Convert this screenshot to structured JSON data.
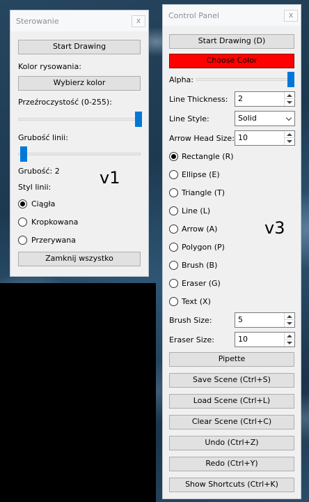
{
  "v1": {
    "title": "Sterowanie",
    "close": "x",
    "start_drawing": "Start Drawing",
    "color_label": "Kolor rysowania:",
    "choose_color": "Wybierz kolor",
    "transparency_label": "Przeźroczystość (0-255):",
    "transparency_value": 255,
    "line_width_label": "Grubość linii:",
    "line_width_value": 2,
    "line_width_readout": "Grubość: 2",
    "line_style_label": "Styl linii:",
    "styles": [
      "Ciągła",
      "Kropkowana",
      "Przerywana"
    ],
    "selected_style": "Ciągła",
    "close_all": "Zamknij wszystko",
    "version_tag": "v1"
  },
  "v3": {
    "title": "Control Panel",
    "close": "x",
    "start_drawing": "Start Drawing (D)",
    "choose_color": "Choose Color",
    "choose_color_bg": "#ff0000",
    "alpha_label": "Alpha:",
    "alpha_value": 255,
    "line_thickness_label": "Line Thickness:",
    "line_thickness_value": "2",
    "line_style_label": "Line Style:",
    "line_style_value": "Solid",
    "arrow_head_label": "Arrow Head Size:",
    "arrow_head_value": "10",
    "shapes": [
      "Rectangle (R)",
      "Ellipse (E)",
      "Triangle (T)",
      "Line (L)",
      "Arrow (A)",
      "Polygon (P)",
      "Brush (B)",
      "Eraser (G)",
      "Text (X)"
    ],
    "selected_shape": "Rectangle (R)",
    "brush_size_label": "Brush Size:",
    "brush_size_value": "5",
    "eraser_size_label": "Eraser Size:",
    "eraser_size_value": "10",
    "buttons": [
      "Pipette",
      "Save Scene (Ctrl+S)",
      "Load Scene (Ctrl+L)",
      "Clear Scene (Ctrl+C)",
      "Undo (Ctrl+Z)",
      "Redo (Ctrl+Y)",
      "Show Shortcuts (Ctrl+K)"
    ],
    "version_tag": "v3"
  },
  "colors": {
    "accent": "#0078d7",
    "window_bg": "#f0f0f0",
    "button_bg": "#e1e1e1",
    "title_text": "#8a8f96"
  }
}
